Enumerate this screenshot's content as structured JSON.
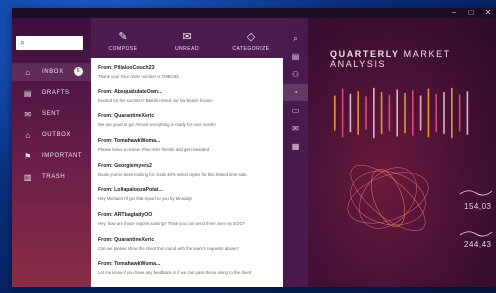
{
  "window_controls": {
    "minimize": "−",
    "maximize": "□",
    "close": "✕"
  },
  "search": {
    "placeholder": ""
  },
  "nav": [
    {
      "label": "INBOX",
      "icon": "inbox-icon",
      "glyph": "⌂",
      "badge": "6",
      "active": true
    },
    {
      "label": "DRAFTS",
      "icon": "drafts-icon",
      "glyph": "▤"
    },
    {
      "label": "SENT",
      "icon": "sent-icon",
      "glyph": "✉"
    },
    {
      "label": "OUTBOX",
      "icon": "outbox-icon",
      "glyph": "⌂"
    },
    {
      "label": "IMPORTANT",
      "icon": "flag-icon",
      "glyph": "⚑"
    },
    {
      "label": "TRASH",
      "icon": "trash-icon",
      "glyph": "▥"
    }
  ],
  "toolbar": {
    "compose": "COMPOSE",
    "unread": "UNREAD",
    "categorize": "CATEGORIZE"
  },
  "messages": [
    {
      "from": "From: PillalooCouch23",
      "preview": "Thank you! Your order number is TMBC83."
    },
    {
      "from": "From: AbsquatulateOwn...",
      "preview": "Excited for the summer? Bambi rented our fav beach house!"
    },
    {
      "from": "From: QuarantineXeric",
      "preview": "We are good to go! Almost everything is ready for next month!"
    },
    {
      "from": "From: TomahawkWoma...",
      "preview": "Please leave a review. Plus refer friends and get rewarded."
    },
    {
      "from": "From: Georgiemyers2",
      "preview": "Deals you've been looking for. Grab 40% select styles for this limited time sale."
    },
    {
      "from": "From: LollapaloozaPotat...",
      "preview": "Hey Michael! I'll get that report to you by Monday!"
    },
    {
      "from": "From: ARTbagladyOO",
      "preview": "Hey, how are those reports looking? Think you can send them over my EOD?"
    },
    {
      "from": "From: QuarantineXeric",
      "preview": "Can we please show the client this round with the team's requests above?"
    },
    {
      "from": "From: TomahawkWoma...",
      "preview": "Let me know if you have any feedback or if we can pass these along to the client"
    }
  ],
  "reader": {
    "title_bold": "QUARTERLY",
    "title_rest": " MARKET ANALYSIS",
    "stat1": "154,03",
    "stat2": "244,43"
  },
  "colors": {
    "accent_orange": "#f6a13a",
    "accent_pink": "#e8507a"
  }
}
